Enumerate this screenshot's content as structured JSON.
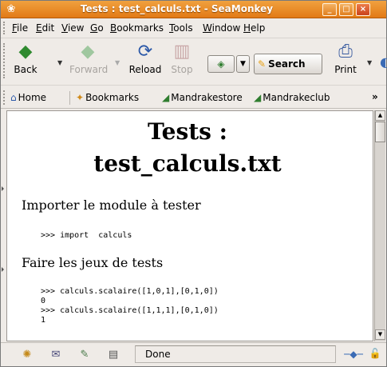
{
  "window": {
    "title": "Tests : test_calculs.txt - SeaMonkey",
    "app_icon": "seamonkey-icon",
    "controls": {
      "minimize": "_",
      "maximize": "□",
      "close": "×"
    }
  },
  "menubar": {
    "items": [
      "File",
      "Edit",
      "View",
      "Go",
      "Bookmarks",
      "Tools",
      "Window",
      "Help"
    ]
  },
  "toolbar": {
    "back": "Back",
    "forward": "Forward",
    "reload": "Reload",
    "stop": "Stop",
    "search": "Search",
    "print": "Print"
  },
  "personal_toolbar": {
    "home": "Home",
    "bookmarks": "Bookmarks",
    "links": [
      "Mandrakestore",
      "Mandrakeclub"
    ],
    "overflow": "»"
  },
  "document": {
    "title_line1": "Tests :",
    "title_line2": "test_calculs.txt",
    "section1": "Importer le module à tester",
    "code1": ">>> import  calculs",
    "section2": "Faire les jeux de tests",
    "code2": [
      ">>> calculs.scalaire([1,0,1],[0,1,0])",
      "0",
      ">>> calculs.scalaire([1,1,1],[0,1,0])",
      "1"
    ]
  },
  "statusbar": {
    "status": "Done"
  },
  "colors": {
    "titlebar": "#e88a2a",
    "chrome": "#efebe7",
    "link_icon": "#2f7d2f"
  }
}
